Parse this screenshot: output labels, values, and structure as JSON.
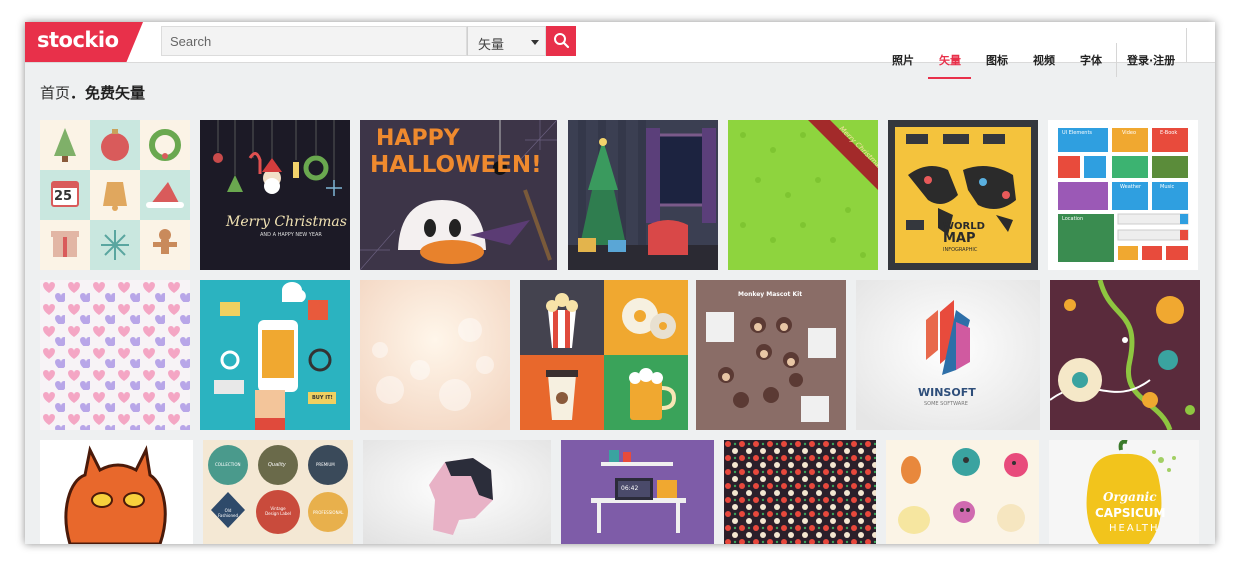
{
  "header": {
    "logo_text": "stockio",
    "search_placeholder": "Search",
    "search_type": "矢量",
    "nav": [
      {
        "label": "照片",
        "active": false
      },
      {
        "label": "矢量",
        "active": true
      },
      {
        "label": "图标",
        "active": false
      },
      {
        "label": "视频",
        "active": false
      },
      {
        "label": "字体",
        "active": false
      }
    ],
    "login_label": "登录·注册"
  },
  "breadcrumb": {
    "home": "首页",
    "separator": "．",
    "current": "免费矢量"
  },
  "thumbnails": {
    "row1": [
      {
        "name": "Christmas icon pattern",
        "text": "25"
      },
      {
        "name": "Merry Christmas ornaments",
        "title": "Merry Christmas",
        "subtitle": "AND A HAPPY NEW YEAR"
      },
      {
        "name": "Happy Halloween",
        "line1": "HAPPY",
        "line2": "HALLOWEEN!"
      },
      {
        "name": "Christmas room with tree"
      },
      {
        "name": "Green Christmas background",
        "ribbon": "Merry Christmas"
      },
      {
        "name": "World map infographic",
        "line1": "WORLD",
        "line2": "MAP",
        "line3": "INFOGRAPHIC"
      },
      {
        "name": "Flat UI elements",
        "labels": [
          "UI Elements",
          "Video",
          "E-Book",
          "Weather",
          "Music",
          "Location"
        ]
      }
    ],
    "row2": [
      {
        "name": "Pastel hearts pattern"
      },
      {
        "name": "Mobile app flat illustration",
        "tag": "BUY IT!"
      },
      {
        "name": "Soft bokeh background"
      },
      {
        "name": "Popcorn donut coffee beer icons"
      },
      {
        "name": "Monkey mascot kit",
        "title": "Monkey Mascot Kit"
      },
      {
        "name": "Winsoft logo",
        "brand": "WINSOFT",
        "tagline": "SOME SOFTWARE"
      },
      {
        "name": "Abstract dots and waves"
      }
    ],
    "row3": [
      {
        "name": "Fire demon mascot"
      },
      {
        "name": "Vintage badges",
        "labels": [
          "COLLECTION",
          "Quality",
          "PREMIUM",
          "Vintage Design Label",
          "Old Fashioned",
          "PROFESSIONAL"
        ]
      },
      {
        "name": "Pixel hand"
      },
      {
        "name": "Flat workspace desk",
        "clock": "06:42"
      },
      {
        "name": "Dotted pattern"
      },
      {
        "name": "Cute monster doodles"
      },
      {
        "name": "Organic capsicum",
        "line1": "Organic",
        "line2": "CAPSICUM",
        "line3": "HEALTH"
      }
    ]
  },
  "colors": {
    "brand_red": "#e8304a",
    "page_bg": "#eef0f1"
  }
}
